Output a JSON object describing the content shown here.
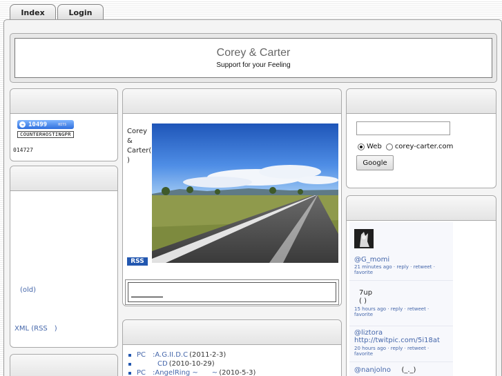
{
  "tabs": {
    "index": "Index",
    "login": "Login"
  },
  "header": {
    "title": "Corey & Carter",
    "subtitle": "Support for your Feeling"
  },
  "left": {
    "counter_badge": "10499",
    "counter_badge_small": "HITS",
    "counter_strip": "COUNTERHOSTINGPR",
    "counter_number": "014727",
    "archive_link": "(old)",
    "xml_link": "XML (RSS　)"
  },
  "center": {
    "intro": "Corey & Carter( )",
    "rss_label": "RSS",
    "news": [
      {
        "title": "PC　:A.G.II.D.C",
        "date": "(2011-2-3)"
      },
      {
        "title": "　　　CD",
        "date": "(2010-10-29)"
      },
      {
        "title": "PC　:AngelRing ~　　~",
        "date": "(2010-5-3)"
      }
    ]
  },
  "search": {
    "input_value": "",
    "radio_web": "Web",
    "radio_site": "corey-carter.com",
    "button_label": "Google"
  },
  "twitter": {
    "tweets": [
      {
        "user": "@G_momi",
        "body": "",
        "meta": "21 minutes ago · reply · retweet · favorite"
      },
      {
        "user": "",
        "body": "7up\n( )",
        "meta": "15 hours ago · reply · retweet · favorite"
      },
      {
        "user": "@liztora",
        "body": "http://twitpic.com/5i18at",
        "meta": "20 hours ago · reply · retweet · favorite"
      },
      {
        "user": "@nanjolno",
        "body": "(_._)",
        "meta": ""
      }
    ]
  }
}
